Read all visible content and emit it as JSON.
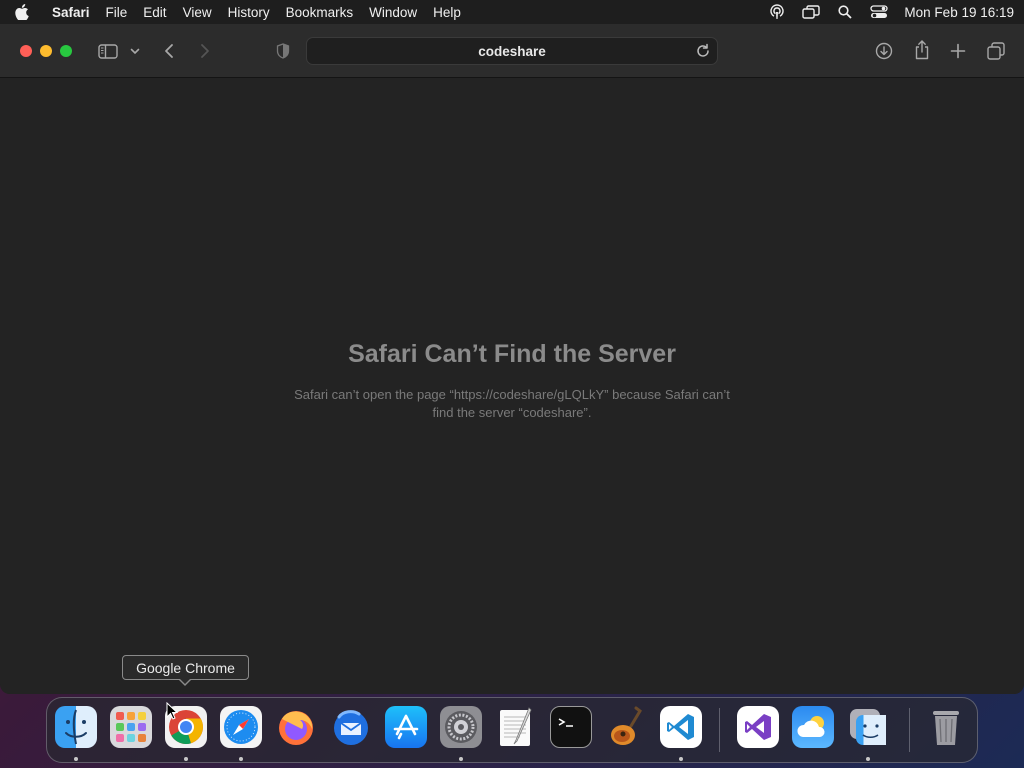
{
  "menubar": {
    "app_name": "Safari",
    "items": [
      "File",
      "Edit",
      "View",
      "History",
      "Bookmarks",
      "Window",
      "Help"
    ],
    "clock": "Mon Feb 19  16:19",
    "status_icons": [
      "podcast-icon",
      "screen-mirroring-icon",
      "spotlight-search-icon",
      "control-center-icon"
    ]
  },
  "toolbar": {
    "address": "codeshare"
  },
  "error": {
    "title": "Safari Can’t Find the Server",
    "message": "Safari can’t open the page “https://codeshare/gLQLkY” because Safari can’t find the server “codeshare”."
  },
  "tooltip": {
    "label": "Google Chrome"
  },
  "dock": {
    "apps": [
      {
        "name": "Finder",
        "icon": "finder-icon",
        "running": true
      },
      {
        "name": "Launchpad",
        "icon": "launchpad-icon",
        "running": false
      },
      {
        "name": "Google Chrome",
        "icon": "chrome-icon",
        "running": true
      },
      {
        "name": "Safari",
        "icon": "safari-icon",
        "running": true
      },
      {
        "name": "Firefox",
        "icon": "firefox-icon",
        "running": false
      },
      {
        "name": "Thunderbird",
        "icon": "thunderbird-icon",
        "running": false
      },
      {
        "name": "App Store",
        "icon": "app-store-icon",
        "running": false
      },
      {
        "name": "System Settings",
        "icon": "system-settings-icon",
        "running": true
      },
      {
        "name": "TextEdit",
        "icon": "textedit-icon",
        "running": false
      },
      {
        "name": "Terminal",
        "icon": "terminal-icon",
        "running": false
      },
      {
        "name": "GarageBand",
        "icon": "garageband-icon",
        "running": false
      },
      {
        "name": "Visual Studio Code",
        "icon": "vscode-icon",
        "running": true
      },
      {
        "name": "Visual Studio",
        "icon": "visual-studio-icon",
        "running": false
      },
      {
        "name": "Weather",
        "icon": "weather-icon",
        "running": false
      },
      {
        "name": "Finder Stack",
        "icon": "finder-stack-icon",
        "running": true
      },
      {
        "name": "Trash",
        "icon": "trash-icon",
        "running": false
      }
    ]
  },
  "colors": {
    "close": "#ff5f57",
    "minimize": "#febc2e",
    "zoom": "#28c840",
    "window_bg": "#232323",
    "toolbar_bg": "#2c2c2c",
    "error_title": "#8b8b8b",
    "error_text": "#7a7a7a"
  }
}
